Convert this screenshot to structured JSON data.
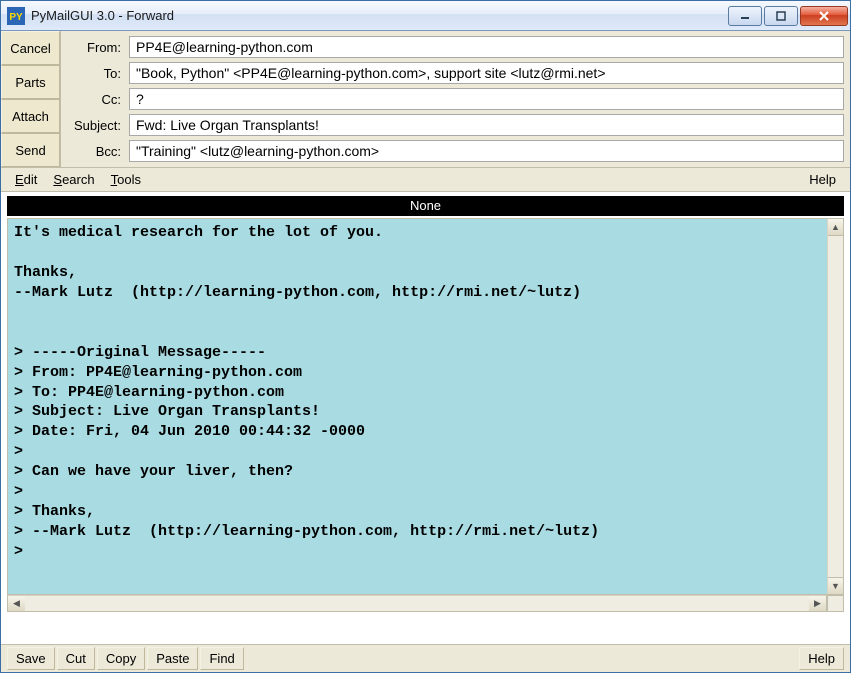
{
  "window": {
    "title": "PyMailGUI 3.0 - Forward",
    "icon_label": "PY"
  },
  "side_buttons": {
    "cancel": "Cancel",
    "parts": "Parts",
    "attach": "Attach",
    "send": "Send"
  },
  "fields": {
    "from_label": "From:",
    "from_value": "PP4E@learning-python.com",
    "to_label": "To:",
    "to_value": "\"Book, Python\" <PP4E@learning-python.com>, support site <lutz@rmi.net>",
    "cc_label": "Cc:",
    "cc_value": "?",
    "subject_label": "Subject:",
    "subject_value": "Fwd: Live Organ Transplants!",
    "bcc_label": "Bcc:",
    "bcc_value": "\"Training\" <lutz@learning-python.com>"
  },
  "menus": {
    "edit": "Edit",
    "search": "Search",
    "tools": "Tools",
    "help": "Help"
  },
  "attachments_label": "None",
  "body": "It's medical research for the lot of you.\n\nThanks,\n--Mark Lutz  (http://learning-python.com, http://rmi.net/~lutz)\n\n\n> -----Original Message-----\n> From: PP4E@learning-python.com\n> To: PP4E@learning-python.com\n> Subject: Live Organ Transplants!\n> Date: Fri, 04 Jun 2010 00:44:32 -0000\n> \n> Can we have your liver, then?\n> \n> Thanks,\n> --Mark Lutz  (http://learning-python.com, http://rmi.net/~lutz)\n> ",
  "toolbar": {
    "save": "Save",
    "cut": "Cut",
    "copy": "Copy",
    "paste": "Paste",
    "find": "Find",
    "help": "Help"
  }
}
